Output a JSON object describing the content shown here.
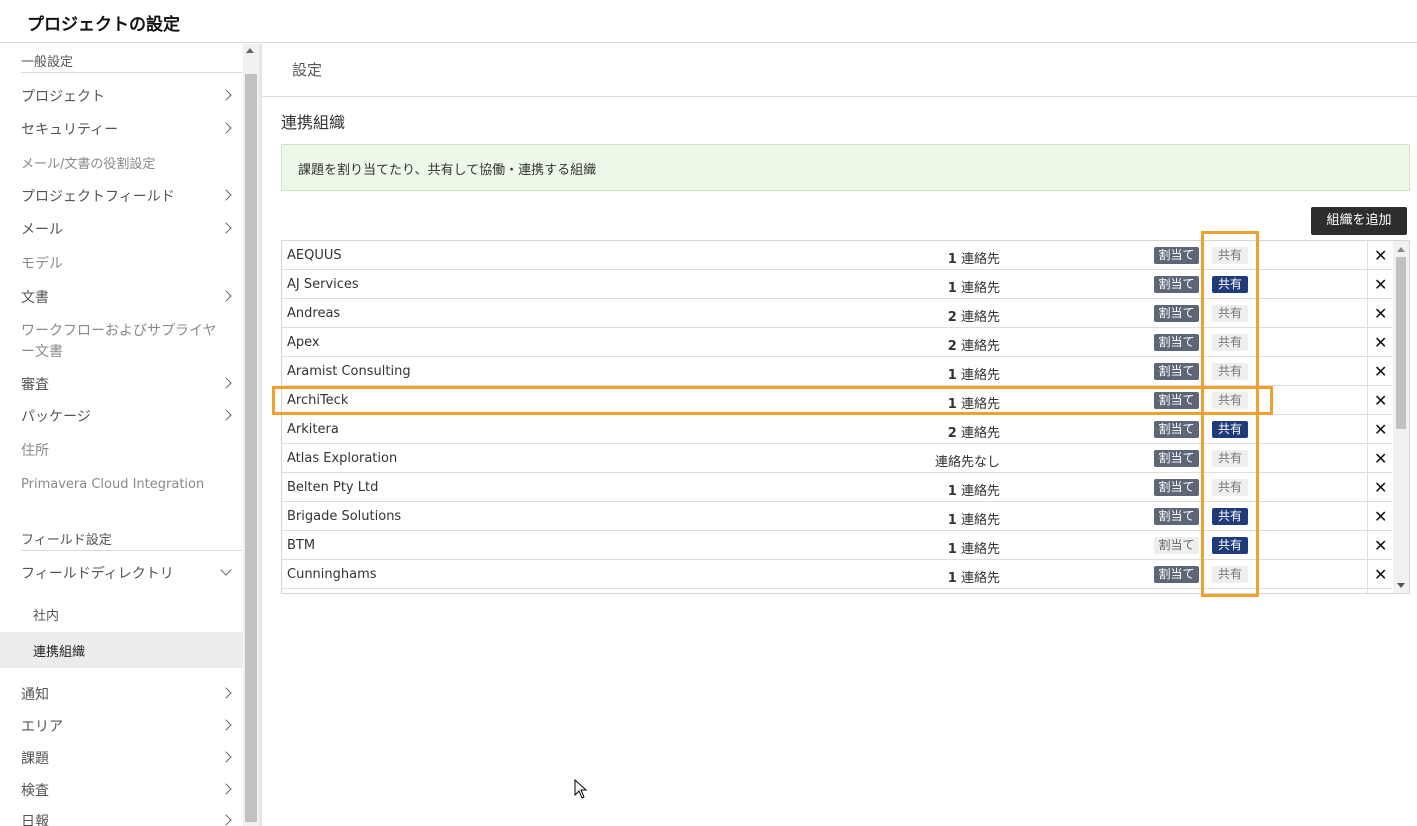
{
  "app": {
    "title": "プロジェクトの設定"
  },
  "sidebar": {
    "sections": [
      {
        "label": "一般設定"
      },
      {
        "label": "フィールド設定"
      }
    ],
    "items": [
      {
        "label": "プロジェクト",
        "chevron": "right",
        "disabled": false
      },
      {
        "label": "セキュリティー",
        "chevron": "right",
        "disabled": false
      },
      {
        "label": "メール/文書の役割設定",
        "chevron": "",
        "disabled": true
      },
      {
        "label": "プロジェクトフィールド",
        "chevron": "right",
        "disabled": false
      },
      {
        "label": "メール",
        "chevron": "right",
        "disabled": false
      },
      {
        "label": "モデル",
        "chevron": "",
        "disabled": true
      },
      {
        "label": "文書",
        "chevron": "right",
        "disabled": false
      },
      {
        "label_line1": "ワークフローおよびサプライヤ",
        "label_line2": "ー文書",
        "chevron": "",
        "disabled": true
      },
      {
        "label": "審査",
        "chevron": "right",
        "disabled": false
      },
      {
        "label": "パッケージ",
        "chevron": "right",
        "disabled": false
      },
      {
        "label": "住所",
        "chevron": "",
        "disabled": true
      },
      {
        "label": "Primavera Cloud Integration",
        "chevron": "",
        "disabled": true
      },
      {
        "label": "フィールドディレクトリ",
        "chevron": "down",
        "disabled": false
      },
      {
        "label": "社内",
        "chevron": "",
        "sub": true
      },
      {
        "label": "連携組織",
        "chevron": "",
        "sub": true,
        "active": true
      },
      {
        "label": "通知",
        "chevron": "right",
        "disabled": false
      },
      {
        "label": "エリア",
        "chevron": "right",
        "disabled": false
      },
      {
        "label": "課題",
        "chevron": "right",
        "disabled": false
      },
      {
        "label": "検査",
        "chevron": "right",
        "disabled": false
      },
      {
        "label": "日報",
        "chevron": "right",
        "disabled": false
      }
    ]
  },
  "main": {
    "breadcrumb": "設定",
    "title": "連携組織",
    "info": "課題を割り当てたり、共有して協働・連携する組織",
    "add_button": "組織を追加",
    "assign_label": "割当て",
    "share_label": "共有",
    "contacts_suffix": "連絡先",
    "delete_glyph": "✕",
    "rows": [
      {
        "name": "AEQUUS",
        "count": "1",
        "contacts_text": "",
        "assign": true,
        "share": false
      },
      {
        "name": "AJ Services",
        "count": "1",
        "contacts_text": "",
        "assign": true,
        "share": true
      },
      {
        "name": "Andreas",
        "count": "2",
        "contacts_text": "",
        "assign": true,
        "share": false
      },
      {
        "name": "Apex",
        "count": "2",
        "contacts_text": "",
        "assign": true,
        "share": false
      },
      {
        "name": "Aramist Consulting",
        "count": "1",
        "contacts_text": "",
        "assign": true,
        "share": false
      },
      {
        "name": "ArchiTeck",
        "count": "1",
        "contacts_text": "",
        "assign": true,
        "share": false
      },
      {
        "name": "Arkitera",
        "count": "2",
        "contacts_text": "",
        "assign": true,
        "share": true
      },
      {
        "name": "Atlas Exploration",
        "count": "",
        "contacts_text": "連絡先なし",
        "assign": true,
        "share": false
      },
      {
        "name": "Belten Pty Ltd",
        "count": "1",
        "contacts_text": "",
        "assign": true,
        "share": false
      },
      {
        "name": "Brigade Solutions",
        "count": "1",
        "contacts_text": "",
        "assign": true,
        "share": true
      },
      {
        "name": "BTM",
        "count": "1",
        "contacts_text": "",
        "assign": false,
        "share": true
      },
      {
        "name": "Cunninghams",
        "count": "1",
        "contacts_text": "",
        "assign": true,
        "share": false
      }
    ]
  },
  "colors": {
    "assign_on": "#5c6676",
    "share_on": "#213a7a",
    "highlight": "#f0a030",
    "info_bg": "#eef8e8"
  }
}
